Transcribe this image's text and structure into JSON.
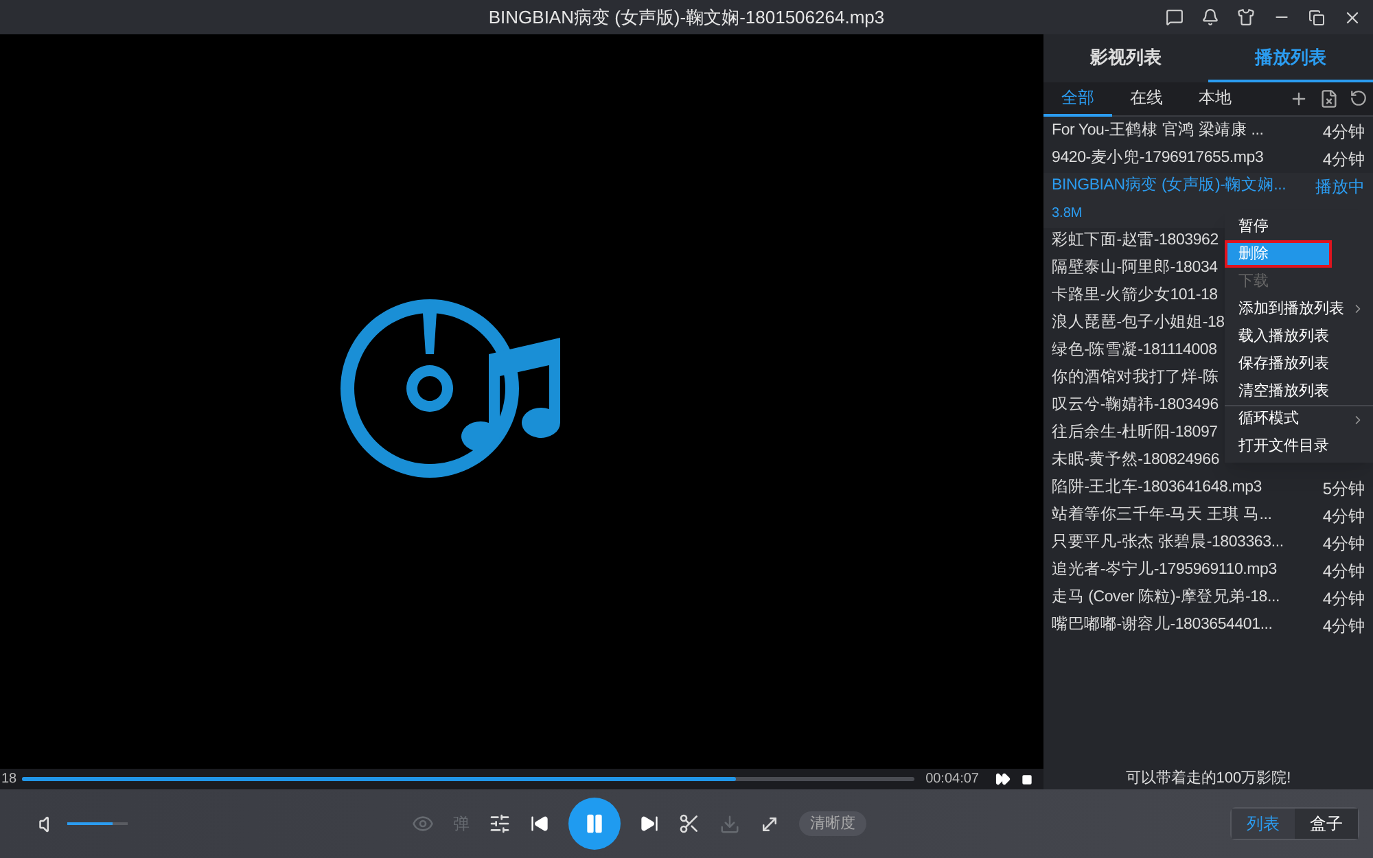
{
  "window": {
    "title": "BINGBIAN病变 (女声版)-鞠文娴-1801506264.mp3"
  },
  "panel_tabs": [
    {
      "label": "影视列表",
      "selected": false
    },
    {
      "label": "播放列表",
      "selected": true
    }
  ],
  "filter_tabs": [
    {
      "label": "全部",
      "selected": true
    },
    {
      "label": "在线",
      "selected": false
    },
    {
      "label": "本地",
      "selected": false
    }
  ],
  "playlist": [
    {
      "title": "For You-王鹤棣  官鸿  梁靖康  ...",
      "duration": "4分钟",
      "playing": false
    },
    {
      "title": "9420-麦小兜-1796917655.mp3",
      "duration": "4分钟",
      "playing": false
    },
    {
      "title": "BINGBIAN病变 (女声版)-鞠文娴...",
      "duration": "播放中",
      "size": "3.8M",
      "playing": true
    },
    {
      "title": "彩虹下面-赵雷-1803962",
      "playing": false
    },
    {
      "title": "隔壁泰山-阿里郎-18034",
      "playing": false
    },
    {
      "title": "卡路里-火箭少女101-18",
      "playing": false
    },
    {
      "title": "浪人琵琶-包子小姐姐-18",
      "playing": false
    },
    {
      "title": "绿色-陈雪凝-181114008",
      "playing": false
    },
    {
      "title": "你的酒馆对我打了烊-陈",
      "playing": false
    },
    {
      "title": "叹云兮-鞠婧祎-1803496",
      "playing": false
    },
    {
      "title": "往后余生-杜昕阳-18097",
      "playing": false
    },
    {
      "title": "未眠-黄予然-180824966",
      "playing": false
    },
    {
      "title": "陷阱-王北车-1803641648.mp3",
      "duration": "5分钟",
      "playing": false
    },
    {
      "title": "站着等你三千年-马天  王琪  马...",
      "duration": "4分钟",
      "playing": false
    },
    {
      "title": "只要平凡-张杰  张碧晨-1803363...",
      "duration": "4分钟",
      "playing": false
    },
    {
      "title": "追光者-岑宁儿-1795969110.mp3",
      "duration": "4分钟",
      "playing": false
    },
    {
      "title": "走马 (Cover 陈粒)-摩登兄弟-18...",
      "duration": "4分钟",
      "playing": false
    },
    {
      "title": "嘴巴嘟嘟-谢容儿-1803654401...",
      "duration": "4分钟",
      "playing": false
    }
  ],
  "context_menu": [
    {
      "label": "暂停",
      "selected": false,
      "disabled": false,
      "submenu": false,
      "separator_before": false
    },
    {
      "label": "删除",
      "selected": true,
      "disabled": false,
      "submenu": false,
      "separator_before": false
    },
    {
      "label": "下载",
      "selected": false,
      "disabled": true,
      "submenu": false,
      "separator_before": false
    },
    {
      "label": "添加到播放列表",
      "selected": false,
      "disabled": false,
      "submenu": true,
      "separator_before": false
    },
    {
      "label": "载入播放列表",
      "selected": false,
      "disabled": false,
      "submenu": false,
      "separator_before": false
    },
    {
      "label": "保存播放列表",
      "selected": false,
      "disabled": false,
      "submenu": false,
      "separator_before": false
    },
    {
      "label": "清空播放列表",
      "selected": false,
      "disabled": false,
      "submenu": false,
      "separator_before": false
    },
    {
      "label": "循环模式",
      "selected": false,
      "disabled": false,
      "submenu": true,
      "separator_before": true
    },
    {
      "label": "打开文件目录",
      "selected": false,
      "disabled": false,
      "submenu": false,
      "separator_before": false
    }
  ],
  "progress": {
    "elapsed": "18",
    "total": "00:04:07",
    "level": 0.8
  },
  "volume": {
    "level": 0.75
  },
  "danmaku_label": "弹",
  "quality_label": "清晰度",
  "promo": "可以带着走的100万影院!",
  "view_tabs": [
    {
      "label": "列表",
      "selected": true
    },
    {
      "label": "盒子",
      "selected": false
    }
  ]
}
